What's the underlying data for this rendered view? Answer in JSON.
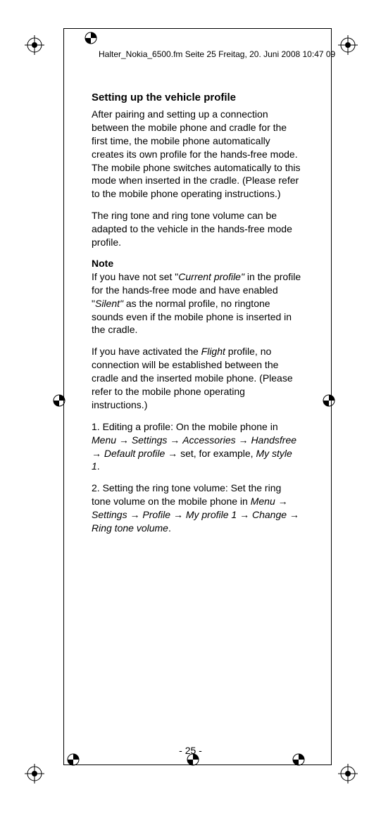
{
  "header": {
    "file_info": "Halter_Nokia_6500.fm  Seite 25  Freitag, 20. Juni 2008  10:47 09"
  },
  "content": {
    "heading": "Setting up the vehicle profile",
    "para1": "After pairing and setting up a connection between the mobile phone and cradle for the first time, the mobile phone automatically creates its own profile for the hands-free mode. The mobile phone switches automatically to this mode when inserted in the cradle. (Please refer to the mobile phone operating instructions.)",
    "para2": "The ring tone and ring tone volume can be adapted to the vehicle in the hands-free mode profile.",
    "note_label": "Note",
    "note_para_pre": "If you have not set \"",
    "note_para_italic1": "Current profile\"",
    "note_para_mid": " in the profile for the hands-free mode and have enabled \"",
    "note_para_italic2": "Silent\"",
    "note_para_post": " as the normal profile, no ringtone sounds even if the mobile phone is inserted in the cradle.",
    "para4_pre": "If you have activated the ",
    "para4_italic": "Flight",
    "para4_post": " profile, no connection will be established between the cradle and the inserted mobile phone. (Please refer to the mobile phone operating instructions.)",
    "step1_pre": "1.    Editing a profile: On the mobile phone in ",
    "step1_menu": "Menu",
    "step1_arr": " → ",
    "step1_settings": "Settings",
    "step1_accessories": "Accessories",
    "step1_handsfree": "Handsfree",
    "step1_default": "Default profile",
    "step1_mid": " set, for example, ",
    "step1_mystyle": "My style 1",
    "step1_end": ".",
    "step2_pre": "2.    Setting the ring tone volume: Set the ring tone volume on the mobile phone in ",
    "step2_menu": "Menu",
    "step2_settings": "Settings",
    "step2_profile": "Profile",
    "step2_myprofile": "My profile 1",
    "step2_change": "Change",
    "step2_ringtone": "Ring tone volume",
    "step2_end": "."
  },
  "footer": {
    "page_num": "- 25 -"
  }
}
